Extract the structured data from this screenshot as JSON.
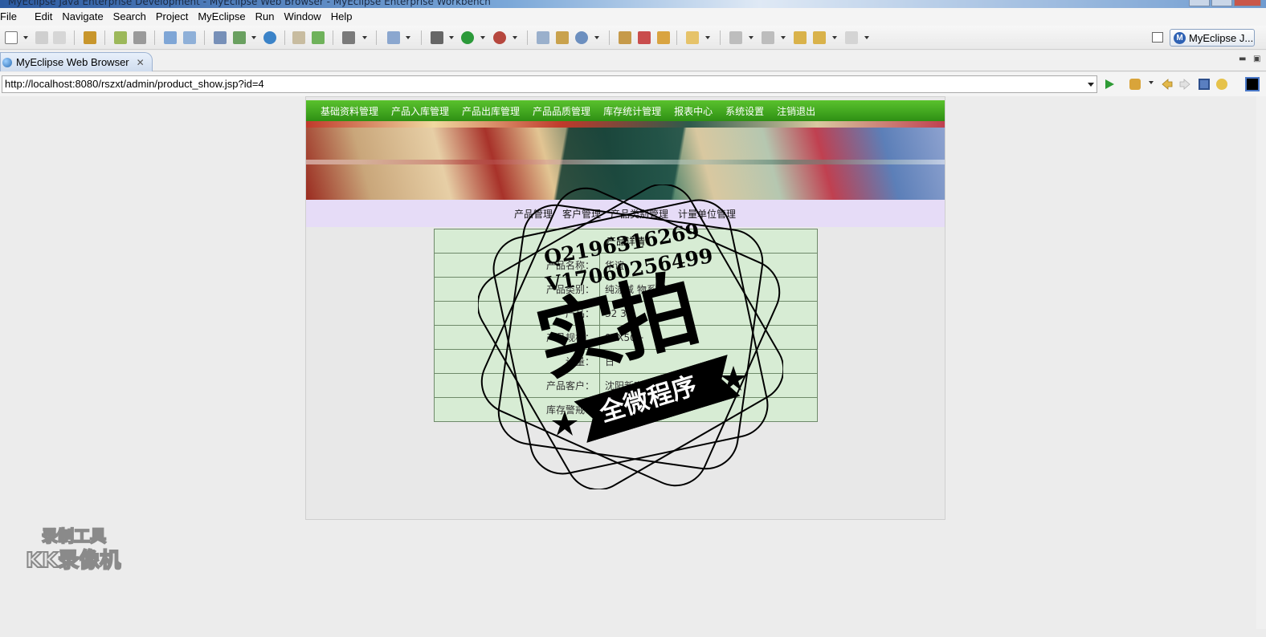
{
  "window": {
    "title": "MyEclipse Java Enterprise Development - MyEclipse Web Browser - MyEclipse Enterprise Workbench"
  },
  "menu": [
    "File",
    "Edit",
    "Navigate",
    "Search",
    "Project",
    "MyEclipse",
    "Run",
    "Window",
    "Help"
  ],
  "perspective": {
    "label": "MyEclipse J..."
  },
  "editor_tab": {
    "label": "MyEclipse Web Browser",
    "close": "✕"
  },
  "address": {
    "url": "http://localhost:8080/rszxt/admin/product_show.jsp?id=4"
  },
  "site_nav": [
    "基础资料管理",
    "产品入库管理",
    "产品出库管理",
    "产品品质管理",
    "库存统计管理",
    "报表中心",
    "系统设置",
    "注销退出"
  ],
  "sub_nav": [
    "产品管理",
    "客户管理",
    "产品类别管理",
    "计量单位管理"
  ],
  "product_form": {
    "rows": [
      {
        "label": "",
        "value": "产品详情"
      },
      {
        "label": "产品名称：",
        "value": "华谊"
      },
      {
        "label": "产品类别：",
        "value": "纯涤减  物系列"
      },
      {
        "label": "产品：",
        "value": "  32     32"
      },
      {
        "label": "产品规格：",
        "value": "99X50+"
      },
      {
        "label": "计量：",
        "value": "日"
      },
      {
        "label": "产品客户：",
        "value": "沈阳新宇日"
      },
      {
        "label": "库存警戒：",
        "value": ""
      }
    ]
  },
  "watermark": {
    "contact1": "Q2196316269",
    "contact2": "V17060256499",
    "big": "实拍",
    "ribbon": "全微程序",
    "recorder1": "录制工具",
    "recorder2": "KK录像机"
  },
  "colors": {
    "nav_green": "#3aa51c",
    "subnav_purple": "#e6dcf7",
    "form_green": "#d7ecd4"
  }
}
